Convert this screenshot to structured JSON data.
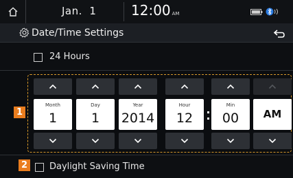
{
  "status": {
    "date": "Jan.  1",
    "time": "12:00",
    "ampm": "AM"
  },
  "header": {
    "title": "Date/Time Settings"
  },
  "options": {
    "hours24_label": "24 Hours",
    "dst_label": "Daylight Saving Time"
  },
  "picker": {
    "fields": [
      {
        "label": "Month",
        "value": "1"
      },
      {
        "label": "Day",
        "value": "1"
      },
      {
        "label": "Year",
        "value": "2014"
      },
      {
        "label": "Hour",
        "value": "12"
      },
      {
        "label": "Min",
        "value": "00"
      },
      {
        "label": "",
        "value": "AM"
      }
    ]
  },
  "badges": {
    "one": "1",
    "two": "2"
  },
  "colors": {
    "background": "#0b0d10",
    "accent": "#ea7d1e",
    "button": "#2d3035"
  },
  "icons": [
    "home-icon",
    "gear-icon",
    "back-icon",
    "battery-icon",
    "bluetooth-icon",
    "chevron-up-icon",
    "chevron-down-icon"
  ]
}
